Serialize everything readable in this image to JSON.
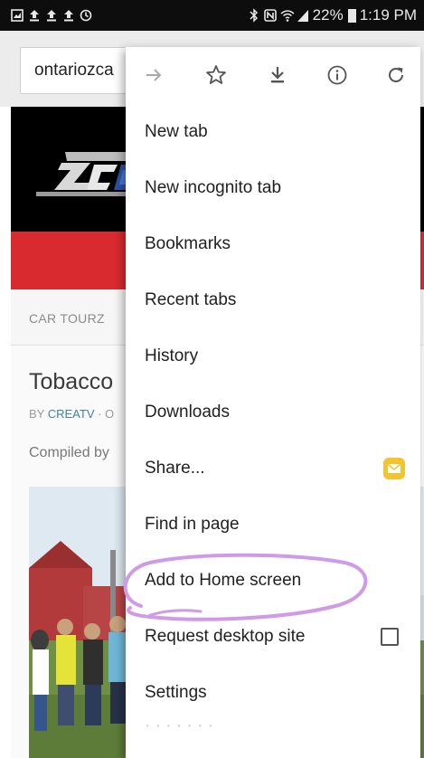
{
  "status_bar": {
    "battery_percent": "22%",
    "time": "1:19 PM",
    "left_icons": [
      "gallery-notification-icon",
      "upload-icon",
      "upload-icon",
      "upload-icon",
      "sync-icon"
    ],
    "right_icons": [
      "bluetooth-icon",
      "nfc-icon",
      "wifi-icon",
      "signal-icon",
      "battery-icon"
    ]
  },
  "browser": {
    "url_text": "ontariozca"
  },
  "page": {
    "nav_item": "CAR TOURZ",
    "article_title": "Tobacco",
    "byline_prefix": "BY ",
    "byline_author": "CREATV",
    "byline_rest": " · O",
    "compiled_text": "Compiled by"
  },
  "menu": {
    "toolbar": [
      "forward-icon",
      "bookmark-star-icon",
      "download-icon",
      "info-icon",
      "refresh-icon"
    ],
    "items": [
      {
        "label": "New tab"
      },
      {
        "label": "New incognito tab"
      },
      {
        "label": "Bookmarks"
      },
      {
        "label": "Recent tabs"
      },
      {
        "label": "History"
      },
      {
        "label": "Downloads"
      },
      {
        "label": "Share..."
      },
      {
        "label": "Find in page"
      },
      {
        "label": "Add to Home screen"
      },
      {
        "label": "Request desktop site"
      },
      {
        "label": "Settings"
      }
    ],
    "share_app_icon": "mail-icon",
    "request_desktop_checked": false
  },
  "colors": {
    "status_bar_bg": "#0d0d0d",
    "site_red": "#d92b2f",
    "highlight_purple": "#cf9be6",
    "mail_badge": "#f4c430",
    "author_link": "#3f7fb5"
  }
}
